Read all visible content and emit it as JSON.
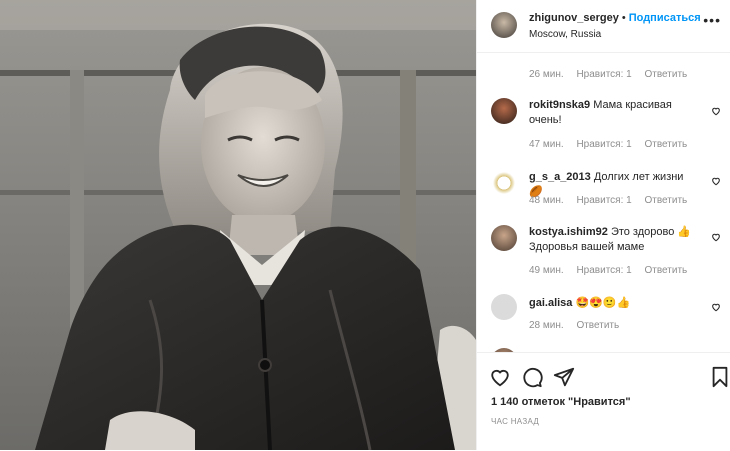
{
  "header": {
    "username": "zhigunov_sergey",
    "dot": "•",
    "follow_label": "Подписаться",
    "location": "Moscow, Russia",
    "more": "•••"
  },
  "comments": [
    {
      "username": "",
      "text": "",
      "time": "26 мин.",
      "likes": "Нравится: 1",
      "reply": "Ответить"
    },
    {
      "username": "rokit9nska9",
      "text": "Мама красивая очень!",
      "time": "47 мин.",
      "likes": "Нравится: 1",
      "reply": "Ответить"
    },
    {
      "username": "g_s_a_2013",
      "text": "Долгих лет жизни 🏉",
      "time": "48 мин.",
      "likes": "Нравится: 1",
      "reply": "Ответить"
    },
    {
      "username": "kostya.ishim92",
      "text": "Это здорово 👍 Здоровья вашей маме",
      "time": "49 мин.",
      "likes": "Нравится: 1",
      "reply": "Ответить"
    },
    {
      "username": "gai.alisa",
      "text": "🤩😍🙂👍",
      "time": "28 мин.",
      "likes": "",
      "reply": "Ответить"
    }
  ],
  "footer": {
    "likes_count": "1 140 отметок \"Нравится\"",
    "time_ago": "ЧАС НАЗАД"
  },
  "icons": {
    "like": "heart-icon",
    "comment": "comment-icon",
    "share": "share-icon",
    "save": "bookmark-icon"
  },
  "colors": {
    "accent": "#0095f6",
    "muted": "#8e8e8e",
    "text": "#262626"
  }
}
